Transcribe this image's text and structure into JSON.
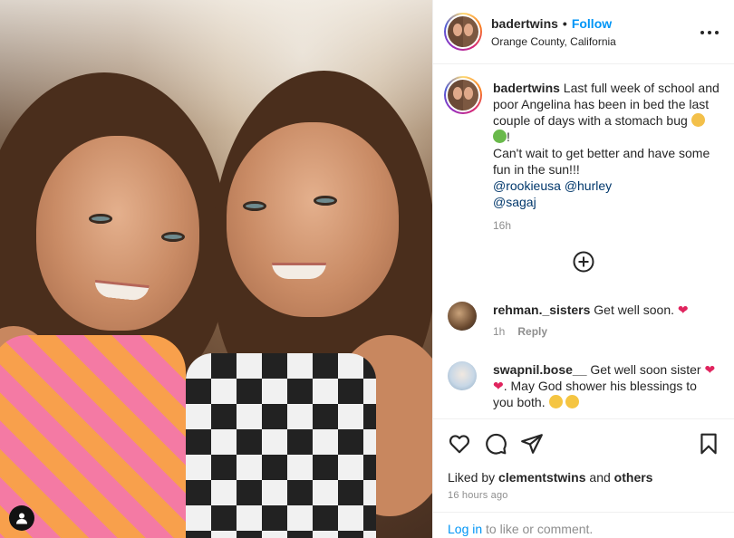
{
  "post": {
    "username": "badertwins",
    "follow_label": "Follow",
    "separator": "•",
    "location": "Orange County, California",
    "caption": {
      "username": "badertwins",
      "line1": "Last full week of school and poor Angelina has been in bed the last couple of days with a stomach bug",
      "exclaim": "!",
      "line2": "Can't wait to get better and have some fun in the sun!!!",
      "mentions": [
        "@rookieusa",
        "@hurley",
        "@sagaj"
      ],
      "time": "16h"
    }
  },
  "comments": [
    {
      "username": "rehman._sisters",
      "text": "Get well soon.",
      "time": "1h",
      "reply_label": "Reply"
    },
    {
      "username": "swapnil.bose__",
      "text_a": "Get well soon sister",
      "text_b": ". May God shower his blessings to you both."
    }
  ],
  "footer": {
    "liked_prefix": "Liked by",
    "liked_user": "clementstwins",
    "liked_and": "and",
    "liked_others": "others",
    "timestamp": "16 hours ago",
    "login_link": "Log in",
    "login_suffix": "to like or comment."
  },
  "colors": {
    "link_blue": "#0095f6",
    "mention_blue": "#00376b",
    "heart_red": "#e0245e",
    "muted": "#8e8e8e"
  },
  "icons": [
    "more-icon",
    "add-comments-icon",
    "heart-icon",
    "comment-icon",
    "share-icon",
    "bookmark-icon",
    "user-tag-icon"
  ]
}
